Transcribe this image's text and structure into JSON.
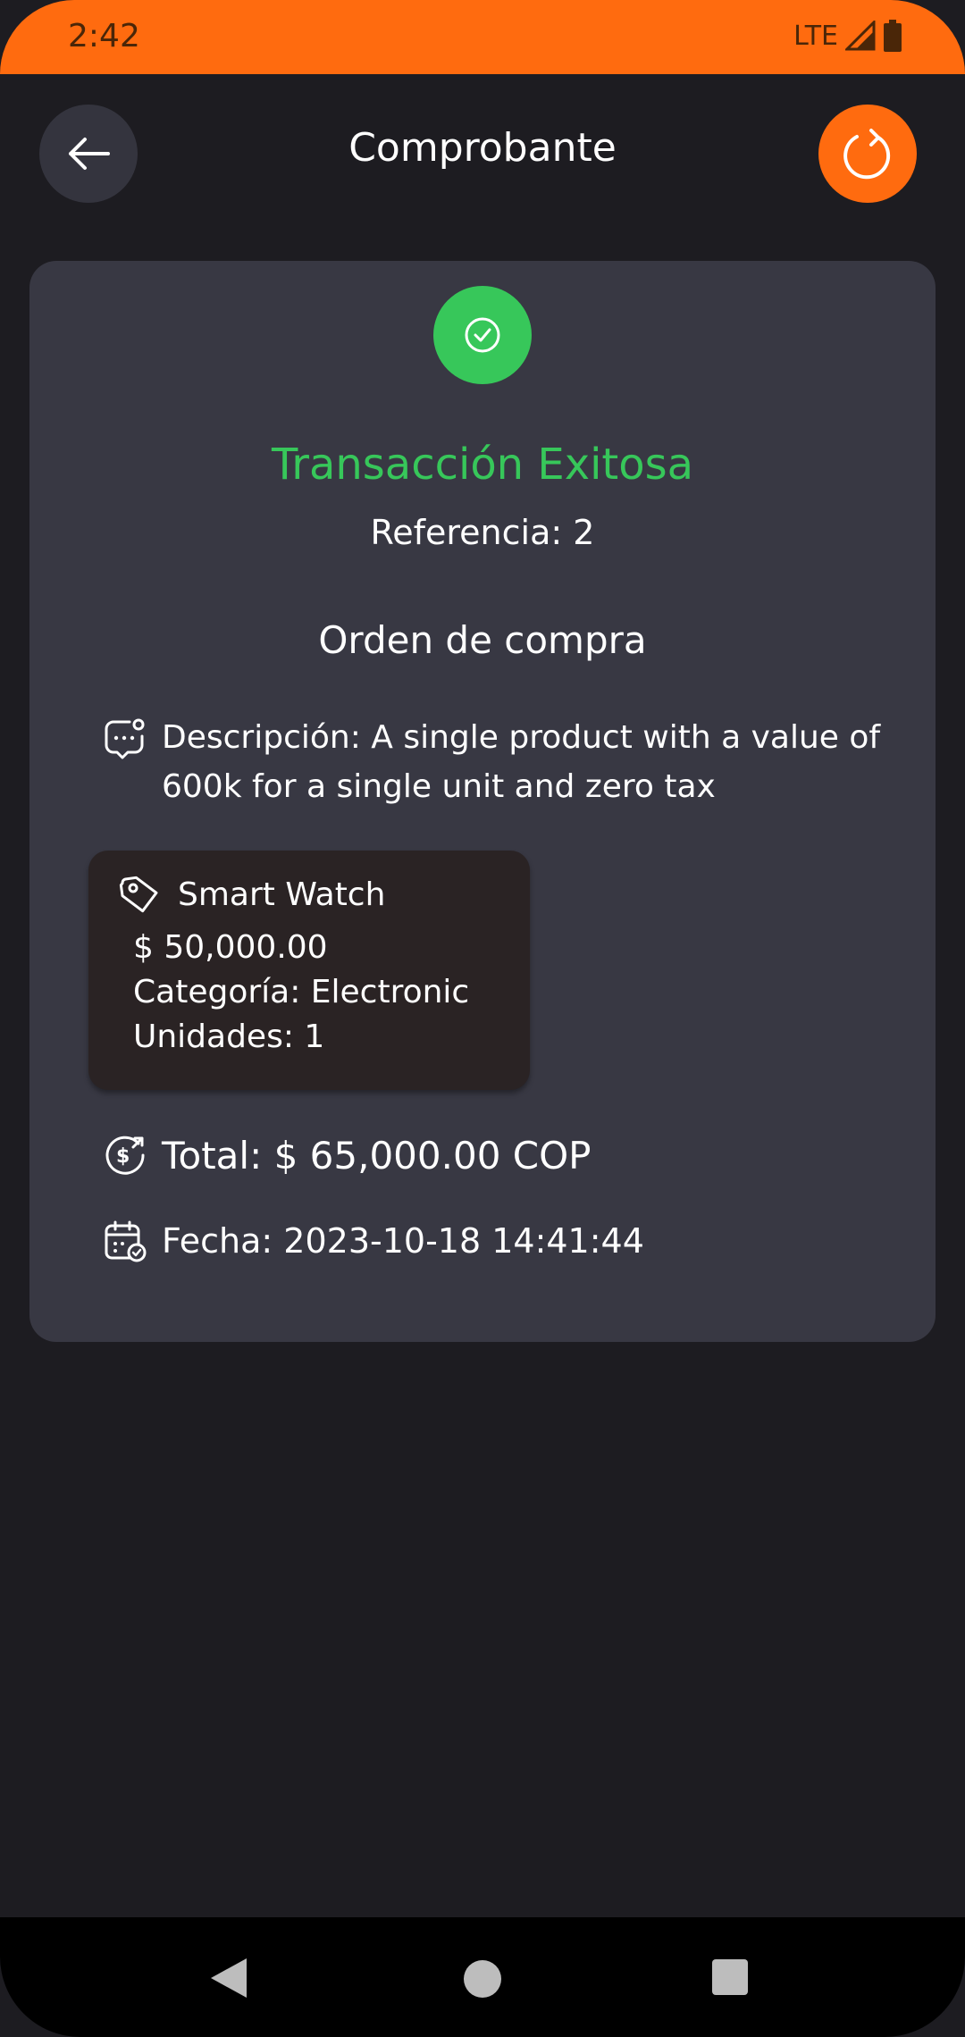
{
  "status_bar": {
    "time": "2:42",
    "network": "LTE"
  },
  "header": {
    "title": "Comprobante",
    "back_icon": "arrow-left-icon",
    "refresh_icon": "refresh-icon"
  },
  "receipt": {
    "status_title": "Transacción Exitosa",
    "reference": "Referencia: 2",
    "order_title": "Orden de compra",
    "description": "Descripción: A single product with a value of 600k for a single unit and zero tax",
    "product": {
      "name": "Smart Watch",
      "price": "$ 50,000.00",
      "category": "Categoría: Electronic",
      "units": "Unidades: 1"
    },
    "total": "Total: $ 65,000.00 COP",
    "date": "Fecha: 2023-10-18 14:41:44"
  },
  "colors": {
    "accent": "#ff6b0f",
    "success": "#37c75a",
    "background": "#1d1c21",
    "card": "#383843"
  }
}
